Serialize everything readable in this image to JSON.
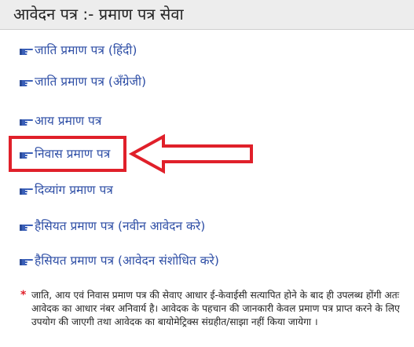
{
  "header": {
    "title": "आवेदन पत्र :-  प्रमाण पत्र सेवा"
  },
  "services": [
    {
      "label": "जाति प्रमाण पत्र (हिंदी)"
    },
    {
      "label": "जाति प्रमाण पत्र (अँग्रेजी)"
    },
    {
      "label": "आय प्रमाण पत्र"
    },
    {
      "label": "निवास प्रमाण पत्र"
    },
    {
      "label": "दिव्यांग प्रमाण पत्र"
    },
    {
      "label": "हैसियत प्रमाण पत्र (नवीन आवेदन करे)"
    },
    {
      "label": "हैसियत प्रमाण पत्र (आवेदन संशोधित करे)"
    }
  ],
  "note": {
    "marker": "*",
    "text": "जाति, आय एवं निवास प्रमाण पत्र की सेवाए आधार ई-केवाईसी सत्यापित होने के बाद ही उपलब्ध होंगी अतः आवेदक का आधार नंबर अनिवार्य है। आवेदक के पहचान की जानकारी केवल प्रमाण पत्र प्राप्त करने के लिए उपयोग की जाएगी तथा आवेदक का बायोमेट्रिक्स संग्रहीत/साझा नहीं किया जायेगा ।"
  },
  "colors": {
    "link": "#2f4fa6",
    "icon": "#3a5fb8",
    "highlight": "#e0202a",
    "header_bg": "#ededed"
  },
  "icons": {
    "service_item": "pointing-hand-icon",
    "annotation": "left-arrow-icon"
  }
}
